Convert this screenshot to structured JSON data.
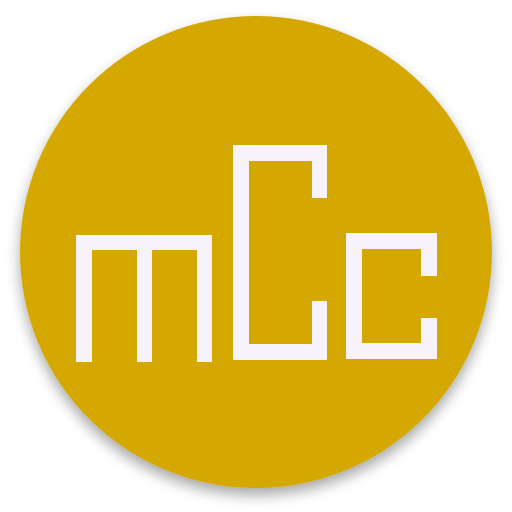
{
  "logo": {
    "text": "mCc",
    "background_color": "#D4A800",
    "glyph_color": "#F8F2FA",
    "shadow_color": "#9A9A9A"
  }
}
